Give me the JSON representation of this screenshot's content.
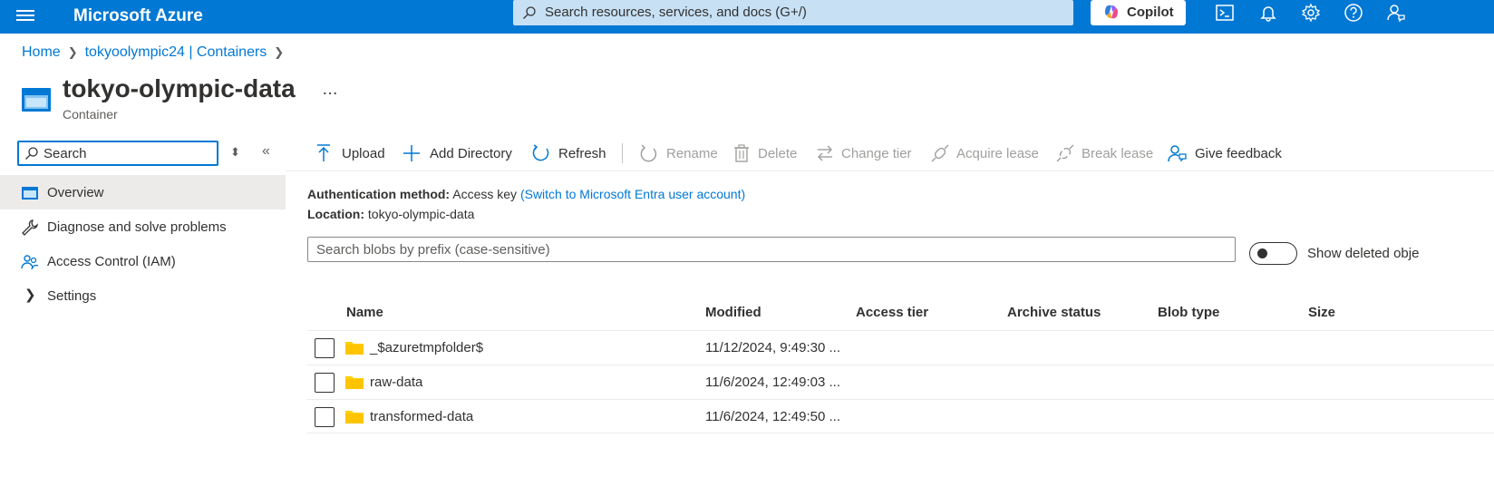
{
  "topbar": {
    "brand": "Microsoft Azure",
    "search_placeholder": "Search resources, services, and docs (G+/)",
    "copilot_label": "Copilot",
    "icons": [
      "cloud-shell-icon",
      "bell-icon",
      "gear-icon",
      "help-icon",
      "feedback-person-icon"
    ]
  },
  "breadcrumb": {
    "items": [
      "Home",
      "tokyoolympic24 | Containers"
    ]
  },
  "header": {
    "title": "tokyo-olympic-data",
    "more": "…",
    "subtitle": "Container"
  },
  "nav": {
    "search_placeholder": "Search",
    "items": [
      {
        "label": "Overview",
        "icon": "container-icon",
        "active": true
      },
      {
        "label": "Diagnose and solve problems",
        "icon": "wrench-icon",
        "active": false
      },
      {
        "label": "Access Control (IAM)",
        "icon": "people-icon",
        "active": false
      },
      {
        "label": "Settings",
        "icon": "chevron-right-icon",
        "active": false
      }
    ]
  },
  "commands": {
    "upload": "Upload",
    "add_directory": "Add Directory",
    "refresh": "Refresh",
    "rename": "Rename",
    "delete": "Delete",
    "change_tier": "Change tier",
    "acquire_lease": "Acquire lease",
    "break_lease": "Break lease",
    "give_feedback": "Give feedback"
  },
  "info": {
    "auth_label": "Authentication method:",
    "auth_value": "Access key",
    "auth_link": "(Switch to Microsoft Entra user account)",
    "location_label": "Location:",
    "location_value": "tokyo-olympic-data"
  },
  "blob_search": {
    "placeholder": "Search blobs by prefix (case-sensitive)",
    "toggle_label": "Show deleted obje",
    "toggle_on": false
  },
  "table": {
    "columns": [
      "Name",
      "Modified",
      "Access tier",
      "Archive status",
      "Blob type",
      "Size"
    ],
    "rows": [
      {
        "name": "_$azuretmpfolder$",
        "modified": "11/12/2024, 9:49:30 ..."
      },
      {
        "name": "raw-data",
        "modified": "11/6/2024, 12:49:03 ..."
      },
      {
        "name": "transformed-data",
        "modified": "11/6/2024, 12:49:50 ..."
      }
    ]
  },
  "colors": {
    "accent": "#0078d4",
    "folder": "#ffd100",
    "active_nav": "#edebe9"
  }
}
